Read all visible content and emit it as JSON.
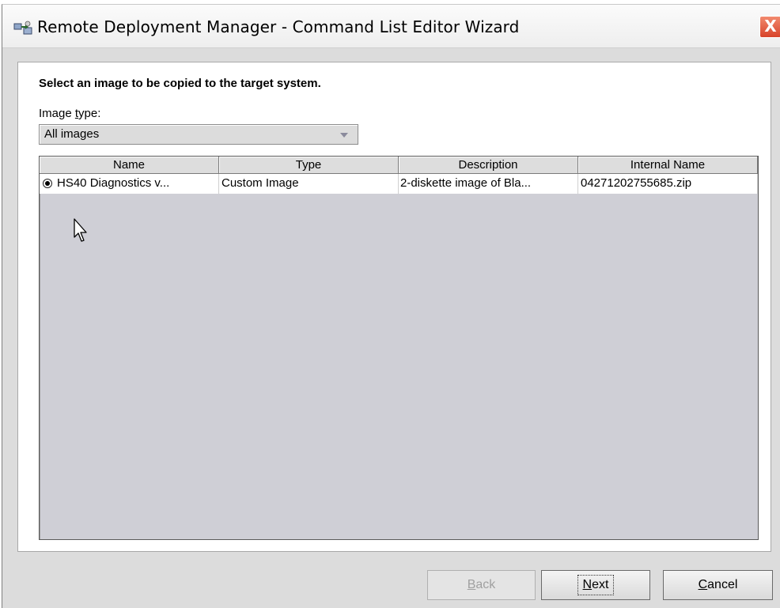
{
  "window": {
    "title": "Remote Deployment Manager - Command List Editor Wizard",
    "close_label": "X"
  },
  "instruction": "Select an image to be copied to the target system.",
  "image_type": {
    "label": "Image type:",
    "selected": "All images"
  },
  "table": {
    "columns": [
      "Name",
      "Type",
      "Description",
      "Internal Name"
    ],
    "rows": [
      {
        "selected": true,
        "name": "HS40 Diagnostics v...",
        "type": "Custom Image",
        "description": "2-diskette image of Bla...",
        "internal_name": "04271202755685.zip"
      }
    ]
  },
  "buttons": {
    "back": {
      "mnemonic": "B",
      "rest": "ack",
      "enabled": false
    },
    "next": {
      "mnemonic": "N",
      "rest": "ext",
      "enabled": true
    },
    "cancel": {
      "mnemonic": "C",
      "rest": "ancel",
      "enabled": true
    }
  },
  "colors": {
    "window_bg": "#dcdcdc",
    "table_bg": "#cfcfd6",
    "close_button": "#d8432a"
  }
}
